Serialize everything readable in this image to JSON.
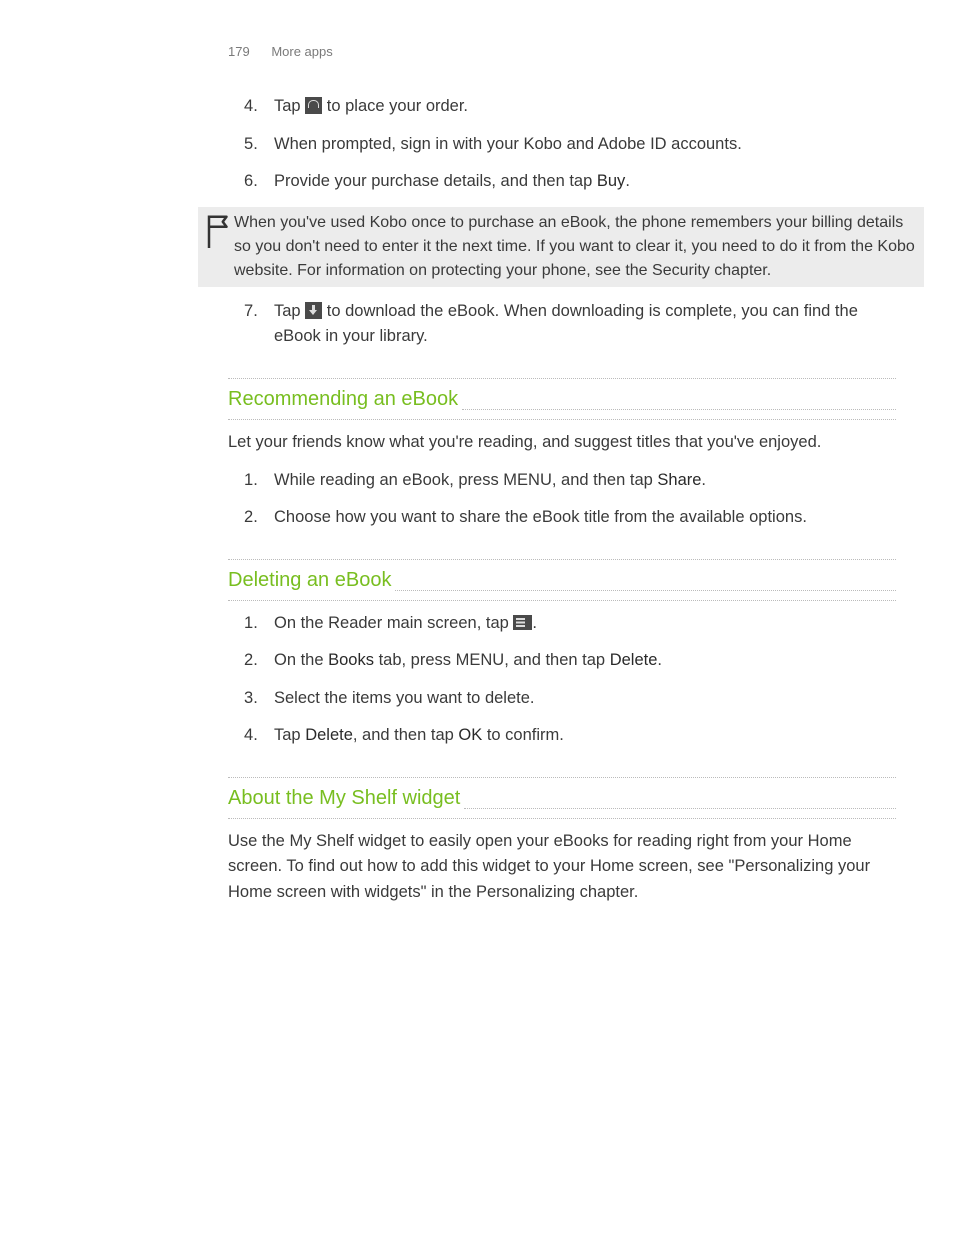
{
  "header": {
    "page_num": "179",
    "section": "More apps"
  },
  "ordersteps": {
    "s4_a": "Tap ",
    "s4_b": " to place your order.",
    "s5": "When prompted, sign in with your Kobo and Adobe ID accounts.",
    "s6_a": "Provide your purchase details, and then tap ",
    "s6_buy": "Buy",
    "s6_b": ".",
    "s7_a": "Tap ",
    "s7_b": " to download the eBook. When downloading is complete, you can find the eBook in your library."
  },
  "note": "When you've used Kobo once to purchase an eBook, the phone remembers your billing details so you don't need to enter it the next time. If you want to clear it, you need to do it from the Kobo website. For information on protecting your phone, see the Security chapter.",
  "section1": {
    "title": "Recommending an eBook",
    "intro": "Let your friends know what you're reading, and suggest titles that you've enjoyed.",
    "s1_a": "While reading an eBook, press MENU, and then tap ",
    "s1_share": "Share",
    "s1_b": ".",
    "s2": "Choose how you want to share the eBook title from the available options."
  },
  "section2": {
    "title": "Deleting an eBook",
    "s1_a": "On the Reader main screen, tap ",
    "s1_b": ".",
    "s2_a": "On the ",
    "s2_books": "Books",
    "s2_b": " tab, press MENU, and then tap ",
    "s2_delete": "Delete",
    "s2_c": ".",
    "s3": "Select the items you want to delete.",
    "s4_a": "Tap ",
    "s4_del": "Delete",
    "s4_b": ", and then tap ",
    "s4_ok": "OK",
    "s4_c": " to confirm."
  },
  "section3": {
    "title": "About the My Shelf widget",
    "body": "Use the My Shelf widget to easily open your eBooks for reading right from your Home screen. To find out how to add this widget to your Home screen, see \"Personalizing your Home screen with widgets\" in the Personalizing chapter."
  }
}
